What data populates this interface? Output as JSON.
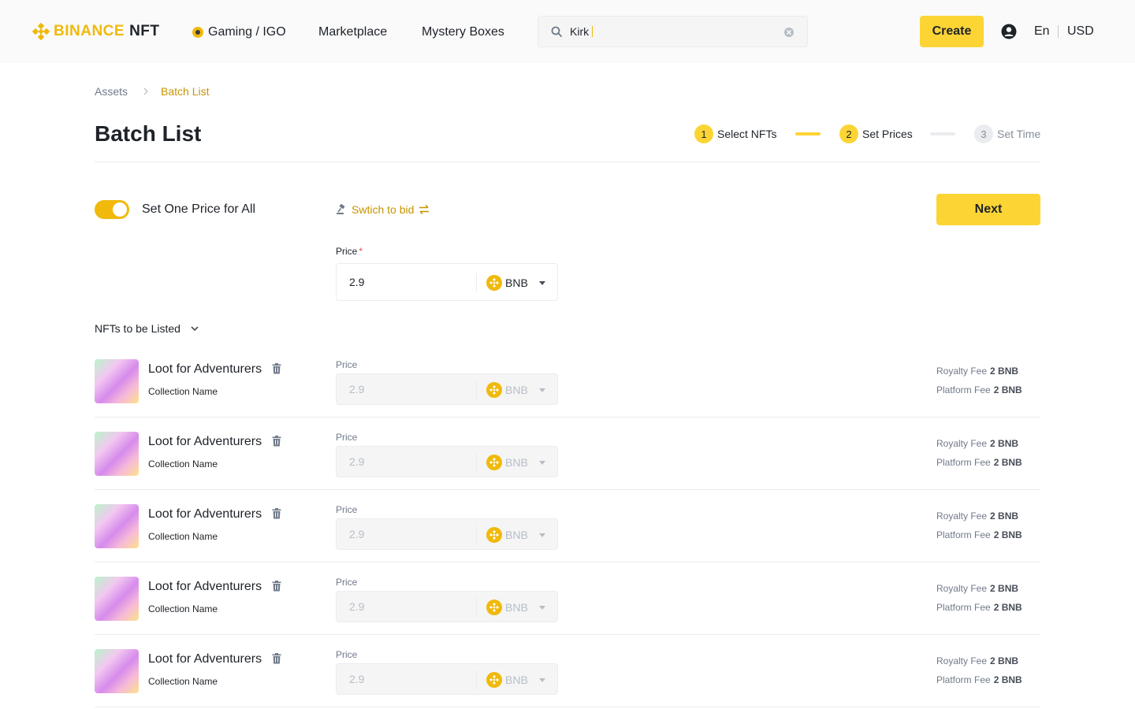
{
  "header": {
    "logo_brand": "BINANCE",
    "logo_product": "NFT",
    "nav": {
      "gaming": "Gaming / IGO",
      "marketplace": "Marketplace",
      "mystery": "Mystery Boxes"
    },
    "search": {
      "value": "Kirk"
    },
    "create_label": "Create",
    "language": "En",
    "currency": "USD"
  },
  "breadcrumb": {
    "root": "Assets",
    "current": "Batch List"
  },
  "page_title": "Batch List",
  "steps": [
    {
      "num": "1",
      "label": "Select NFTs",
      "state": "done"
    },
    {
      "num": "2",
      "label": "Set Prices",
      "state": "active"
    },
    {
      "num": "3",
      "label": "Set Time",
      "state": "inactive"
    }
  ],
  "toolbar": {
    "toggle_label": "Set One Price for All",
    "toggle_on": true,
    "switch_label": "Swtich to bid",
    "next_label": "Next"
  },
  "main_price": {
    "label": "Price",
    "required_mark": "*",
    "value": "2.9",
    "currency": "BNB"
  },
  "list": {
    "header": "NFTs to be Listed",
    "items": [
      {
        "name": "Loot for Adventurers",
        "collection": "Collection Name",
        "price_label": "Price",
        "price": "2.9",
        "currency": "BNB",
        "royalty_label": "Royalty Fee",
        "royalty_value": "2 BNB",
        "platform_label": "Platform Fee",
        "platform_value": "2 BNB"
      },
      {
        "name": "Loot for Adventurers",
        "collection": "Collection Name",
        "price_label": "Price",
        "price": "2.9",
        "currency": "BNB",
        "royalty_label": "Royalty Fee",
        "royalty_value": "2 BNB",
        "platform_label": "Platform Fee",
        "platform_value": "2 BNB"
      },
      {
        "name": "Loot for Adventurers",
        "collection": "Collection Name",
        "price_label": "Price",
        "price": "2.9",
        "currency": "BNB",
        "royalty_label": "Royalty Fee",
        "royalty_value": "2 BNB",
        "platform_label": "Platform Fee",
        "platform_value": "2 BNB"
      },
      {
        "name": "Loot for Adventurers",
        "collection": "Collection Name",
        "price_label": "Price",
        "price": "2.9",
        "currency": "BNB",
        "royalty_label": "Royalty Fee",
        "royalty_value": "2 BNB",
        "platform_label": "Platform Fee",
        "platform_value": "2 BNB"
      },
      {
        "name": "Loot for Adventurers",
        "collection": "Collection Name",
        "price_label": "Price",
        "price": "2.9",
        "currency": "BNB",
        "royalty_label": "Royalty Fee",
        "royalty_value": "2 BNB",
        "platform_label": "Platform Fee",
        "platform_value": "2 BNB"
      }
    ]
  },
  "colors": {
    "accent": "#fcd535",
    "brand": "#f0b90b",
    "link": "#c99400",
    "text": "#1e2329",
    "muted": "#707a8a"
  },
  "icons": {
    "logo": "binance-diamond-icon",
    "search": "search-icon",
    "clear": "clear-circle-icon",
    "user": "user-circle-icon",
    "trash": "trash-icon",
    "bnb": "bnb-coin-icon",
    "auction": "auction-hammer-icon",
    "swap": "swap-arrows-icon",
    "chevron": "chevron-down-icon"
  }
}
